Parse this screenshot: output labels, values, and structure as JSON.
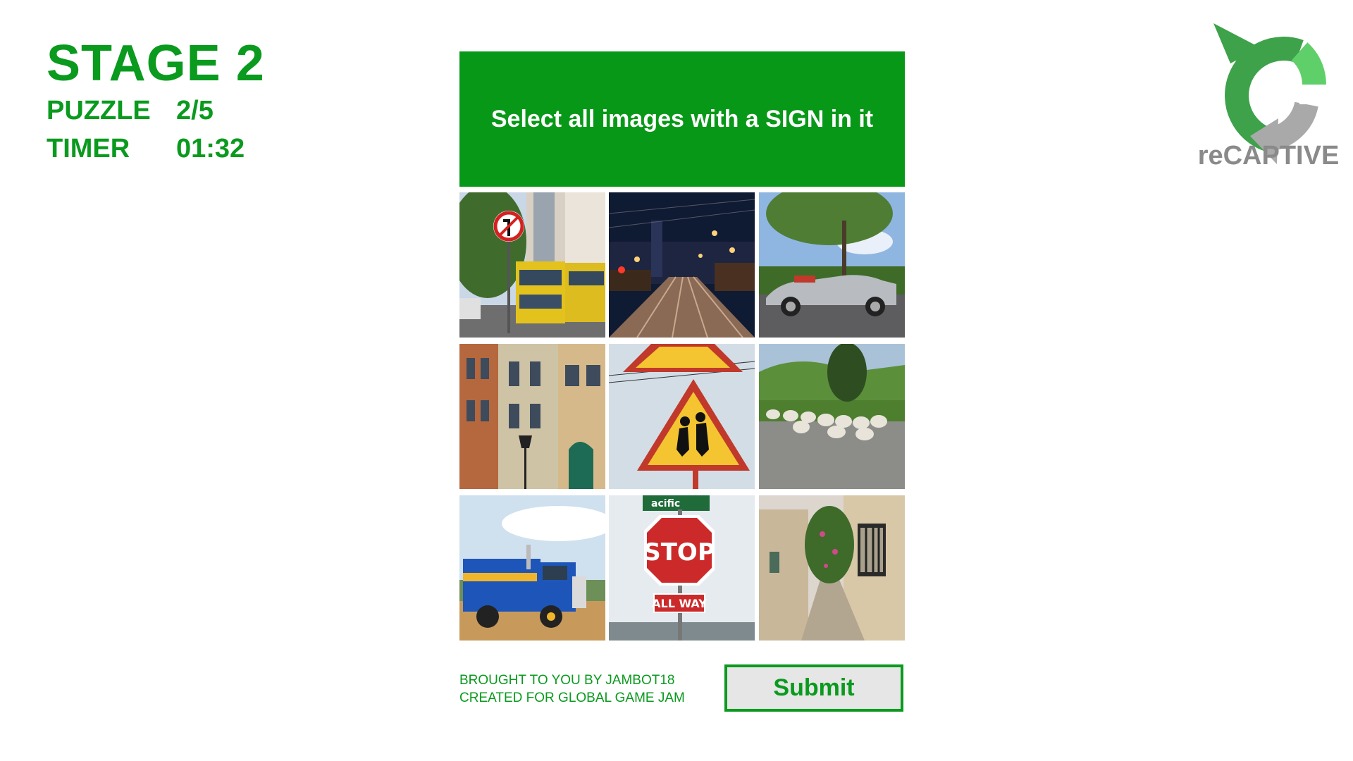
{
  "hud": {
    "stage": "STAGE 2",
    "puzzle_label": "PUZZLE",
    "puzzle_value": "2/5",
    "timer_label": "TIMER",
    "timer_value": "01:32"
  },
  "prompt": "Select all images with a SIGN in it",
  "tiles": [
    {
      "subject": "street with buses and no-left-turn sign"
    },
    {
      "subject": "city street at night with tram tracks"
    },
    {
      "subject": "vintage silver convertible car"
    },
    {
      "subject": "historic building facade with street lamp"
    },
    {
      "subject": "children crossing warning sign"
    },
    {
      "subject": "flock of sheep on a road"
    },
    {
      "subject": "blue and yellow truck"
    },
    {
      "subject": "stop sign",
      "sign_text": "STOP",
      "sub_sign_text": "ALL WAY",
      "street_sign_text": "acific"
    },
    {
      "subject": "narrow stone alley with flowers"
    }
  ],
  "footer": {
    "line1": "BROUGHT TO YOU BY JAMBOT18",
    "line2": "CREATED FOR GLOBAL GAME JAM"
  },
  "submit_label": "Submit",
  "logo": {
    "text": "reCAPTIVE",
    "icon": "recaptive-logo-icon"
  },
  "colors": {
    "accent": "#089818",
    "text_green": "#0a9a1e",
    "logo_gray": "#8a8a8a",
    "button_bg": "#e6e6e6"
  }
}
